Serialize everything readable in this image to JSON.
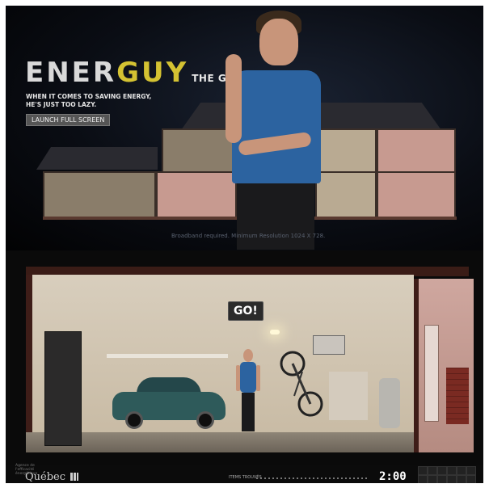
{
  "top_panel": {
    "logo": {
      "part1": "ENER",
      "part2": "GUY",
      "subtitle": "THE GAME"
    },
    "tagline": "WHEN IT COMES TO SAVING ENERGY, HE'S JUST TOO LAZY.",
    "launch_button": "LAUNCH FULL SCREEN",
    "requirements": "Broadband required. Minimum Resolution 1024 X 728."
  },
  "bottom_panel": {
    "go_label": "GO!",
    "hud": {
      "publisher_small": "Agence de l'efficacité énergétique",
      "publisher_name": "Québec",
      "items_label": "ITEMS TROUVÉS",
      "timer": "2:00"
    }
  },
  "colors": {
    "logo_accent": "#d4c232",
    "shirt": "#2c63a0",
    "brick": "#7a2a22"
  }
}
